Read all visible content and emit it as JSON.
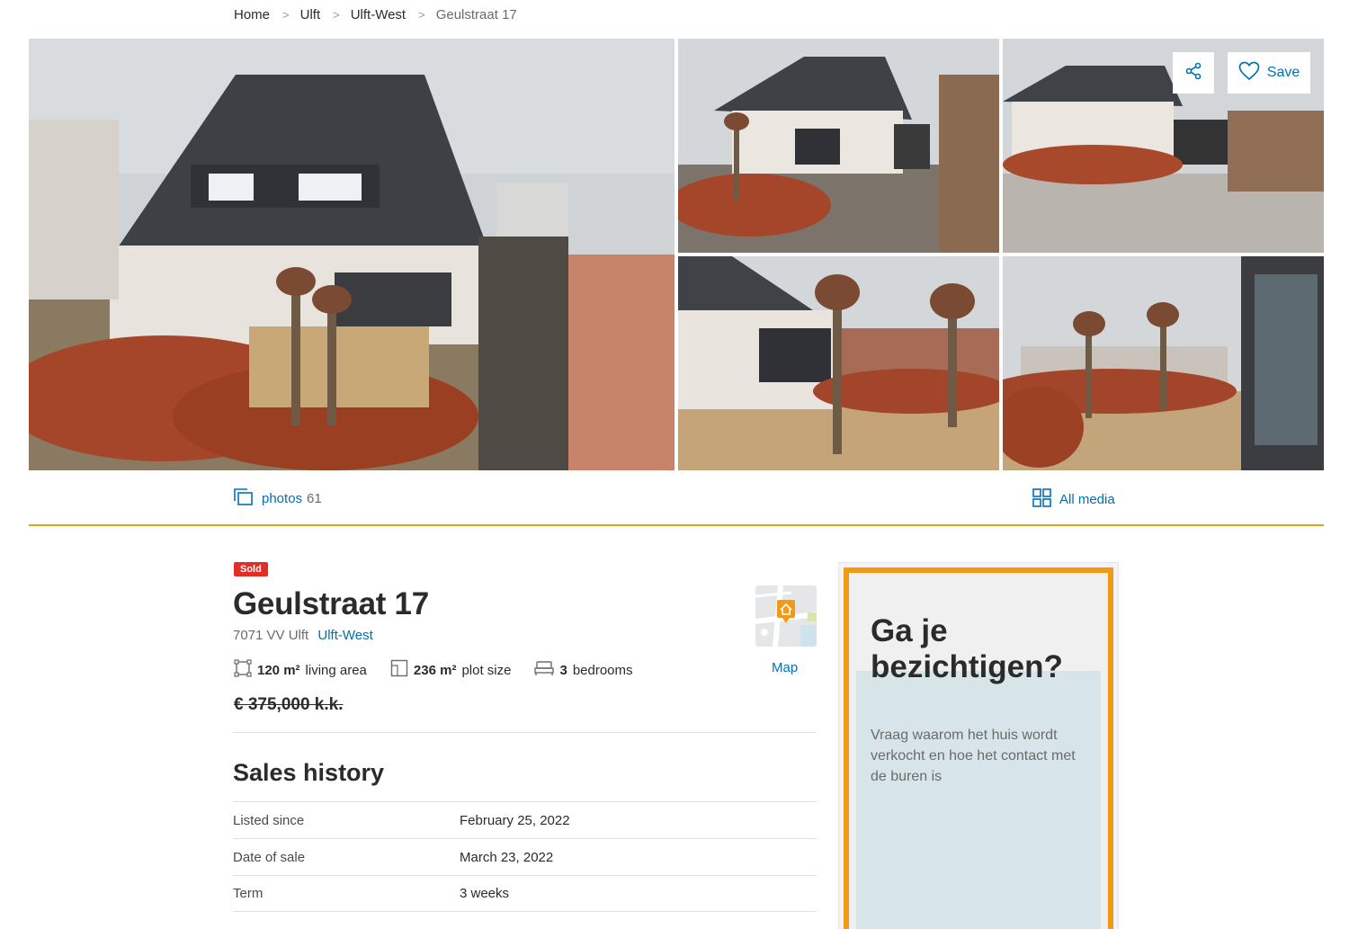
{
  "breadcrumb": {
    "items": [
      "Home",
      "Ulft",
      "Ulft-West",
      "Geulstraat 17"
    ],
    "separator": ">"
  },
  "gallery": {
    "photos": [
      {
        "subject": "aerial view of semi-detached house with driveway"
      },
      {
        "subject": "front view of house and driveway"
      },
      {
        "subject": "front view of house with paved driveway"
      },
      {
        "subject": "front garden with pruned trees"
      },
      {
        "subject": "side garden with hedges and tiles"
      }
    ],
    "share_icon": "share-icon",
    "save_label": "Save",
    "save_icon": "heart-icon"
  },
  "media_bar": {
    "photos_label": "photos",
    "photos_count": "61",
    "all_media_label": "All media"
  },
  "listing": {
    "status": "Sold",
    "address": "Geulstraat 17",
    "postal_city": "7071 VV Ulft",
    "neighbourhood": "Ulft-West",
    "features": [
      {
        "value": "120 m²",
        "label": "living area",
        "icon": "living-area-icon"
      },
      {
        "value": "236 m²",
        "label": "plot size",
        "icon": "plot-size-icon"
      },
      {
        "value": "3",
        "label": "bedrooms",
        "icon": "bed-icon"
      }
    ],
    "price": "€ 375,000 k.k.",
    "map_label": "Map"
  },
  "sales_history": {
    "title": "Sales history",
    "rows": [
      {
        "key": "Listed since",
        "value": "February 25, 2022"
      },
      {
        "key": "Date of sale",
        "value": "March 23, 2022"
      },
      {
        "key": "Term",
        "value": "3 weeks"
      }
    ]
  },
  "ad": {
    "headline": "Ga je bezichtigen?",
    "body": "Vraag waarom het huis wordt verkocht en hoe het contact met de buren is"
  },
  "colors": {
    "link": "#0071b3",
    "sold_badge": "#e32d26",
    "divider": "#e6a11a",
    "ad_border": "#f39a14"
  }
}
